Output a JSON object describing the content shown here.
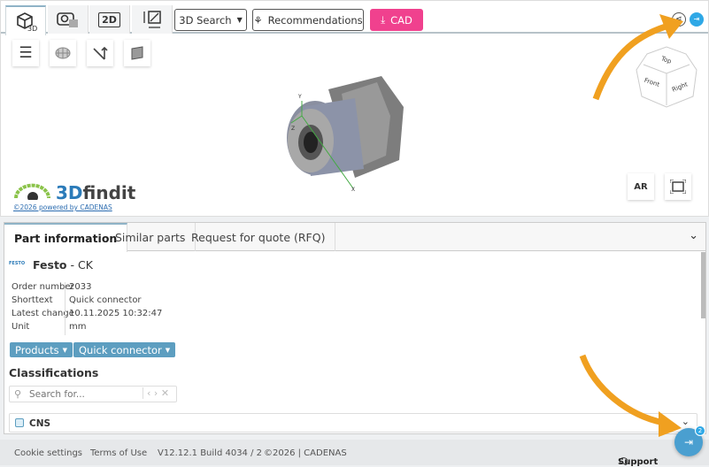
{
  "toolbar": {
    "tabs": [
      {
        "icon": "cube-3d-icon",
        "label": "3D"
      },
      {
        "icon": "camera-cube-icon"
      },
      {
        "icon": "2d-icon",
        "label": "2D"
      },
      {
        "icon": "dimensions-icon"
      }
    ],
    "search_label": "3D Search",
    "recommendations_label": "Recommendations",
    "cad_label": "CAD"
  },
  "viewer": {
    "tools": [
      "list-icon",
      "wireframe-icon",
      "measure-icon",
      "section-icon"
    ],
    "cube": {
      "top": "Top",
      "front": "Front",
      "right": "Right"
    },
    "axes": {
      "x": "X",
      "y": "Y",
      "z": "Z"
    },
    "ar_label": "AR",
    "logo": {
      "brand_a": "3D",
      "brand_b": "findit",
      "link": "©2026 powered by CADENAS"
    }
  },
  "panel": {
    "tabs": [
      "Part information",
      "Similar parts",
      "Request for quote (RFQ)"
    ],
    "manufacturer_logo": "FESTO",
    "manufacturer": "Festo",
    "model": " - CK",
    "fields": [
      {
        "label": "Order number",
        "value": "2033"
      },
      {
        "label": "Shorttext",
        "value": "Quick connector"
      },
      {
        "label": "Latest change",
        "value": "10.11.2025 10:32:47"
      },
      {
        "label": "Unit",
        "value": "mm"
      }
    ],
    "chips": [
      "Products",
      "Quick connector"
    ],
    "classifications_title": "Classifications",
    "search_placeholder": "Search for...",
    "tree_item": "CNS"
  },
  "footer": {
    "cookie": "Cookie settings",
    "terms": "Terms of Use",
    "version": "V12.12.1 Build 4034 / 2",
    "copyright": "©2026 | CADENAS",
    "support": "Support",
    "badge": "2"
  },
  "colors": {
    "accent": "#f0418e",
    "chip": "#5d9ec0",
    "arrow": "#f0a020",
    "fab": "#4a9fd0"
  }
}
